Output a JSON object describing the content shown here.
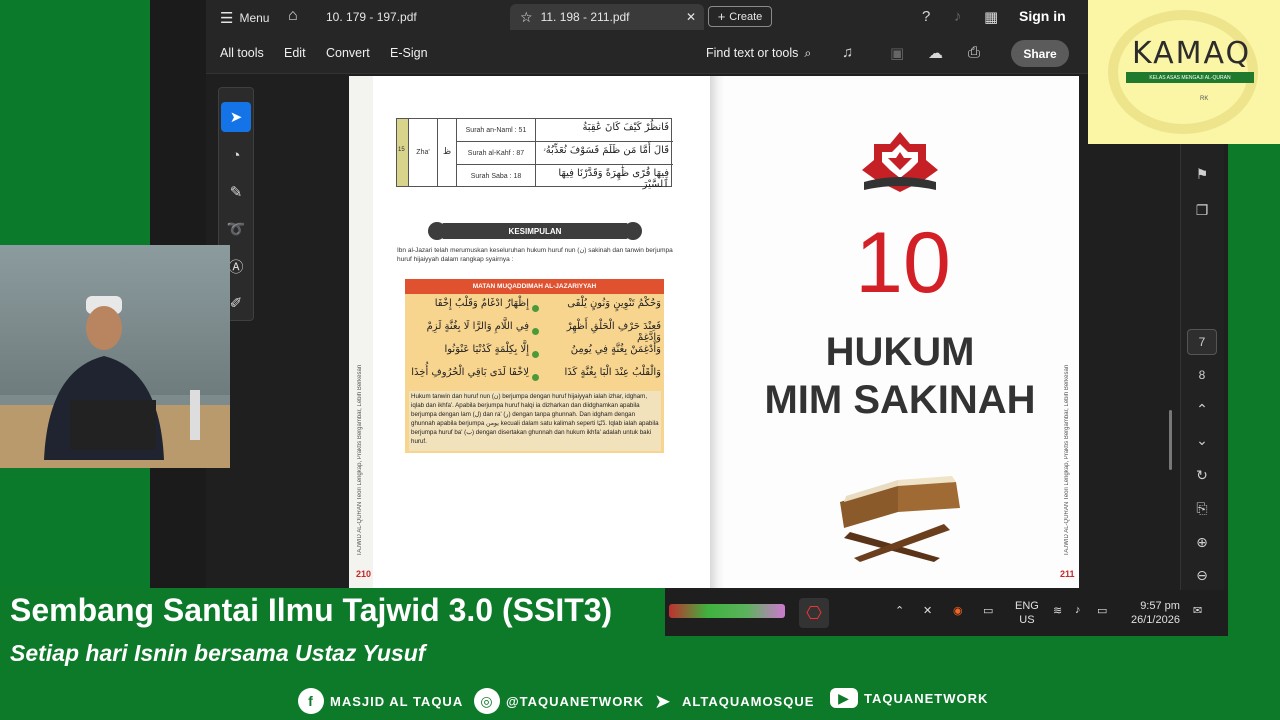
{
  "acrobat": {
    "menu_label": "Menu",
    "tabs": [
      {
        "label": "10. 179 - 197.pdf"
      },
      {
        "label": "11. 198 - 211.pdf"
      }
    ],
    "create_label": "Create",
    "sign_in": "Sign in",
    "menu": [
      "All tools",
      "Edit",
      "Convert",
      "E-Sign"
    ],
    "find_label": "Find text or tools",
    "share_label": "Share",
    "pages": {
      "current": "7",
      "next": "8"
    }
  },
  "left_page": {
    "table": {
      "number": "15",
      "letter_name": "Zha'",
      "letter": "ظ",
      "rows": [
        {
          "surah": "Surah an-Naml : 51",
          "arabic": "فَانظُرْ كَيْفَ كَانَ عَٰقِبَةُ"
        },
        {
          "surah": "Surah al-Kahf : 87",
          "arabic": "قَالَ أَمَّا مَن ظَلَمَ فَسَوْفَ نُعَذِّبُهُۥ"
        },
        {
          "surah": "Surah Saba : 18",
          "arabic": "فِيهَا قُرًى ظَٰهِرَةً وَقَدَّرْنَا فِيهَا ٱلسَّيْرَ"
        }
      ]
    },
    "kesimpulan": "KESIMPULAN",
    "intro": "Ibn al-Jazari telah merumuskan keseluruhan hukum huruf nun (ن) sakinah dan tanwin berjumpa huruf hijaiyyah dalam rangkap syairnya :",
    "matan_title": "MATAN MUQADDIMAH AL-JAZARIYYAH",
    "verses": [
      {
        "right": "وَحُكْمُ تَنْوِينٍ وَنُونٍ يُلْفَى",
        "left": "إِظْهَارٌ ادْغَامٌ وَقَلْبٌ إِخْفَا"
      },
      {
        "right": "فَعِنْدَ حَرْفِ الْحَلْقِ أَظْهِرْ وَادَّغِمْ",
        "left": "فِي اللَّامِ وَالرَّا لَا بِغُنَّةٍ لَزِمْ"
      },
      {
        "right": "وَأَدْغِمَنْ بِغُنَّةٍ فِي يُومِنُ",
        "left": "إِلَّا بِكِلْمَةٍ كَدُنْيَا عَنْوَنُوا"
      },
      {
        "right": "وَالْقَلْبُ عِنْدَ الْبَا بِغُنَّةٍ كَذَا",
        "left": "لِاخْفَا لَدَى بَاقِي الْحُرُوفِ أُخِذَا"
      }
    ],
    "note": "Hukum tanwin dan huruf nun (ن) berjumpa dengan huruf hijaiyyah ialah izhar, idgham, iqlab dan ikhfa'. Apabila berjumpa huruf halqi ia dizharkan dan diidghamkan apabila berjumpa dengan lam (ل) dan ra' (ر) dengan tanpa ghunnah. Dan idgham dengan ghunnah apabila berjumpa يومن kecuali dalam satu kalimah seperti دُنْيَا. Iqlab ialah apabila berjumpa huruf ba' (ب) dengan disertakan ghunnah dan hukum ikhfa' adalah untuk baki huruf.",
    "spine": "TAJWID AL-QURAN Teori Lengkap, Praktis Bergambar, Lebih Berkesan",
    "page_number": "210"
  },
  "right_page": {
    "chapter_number": "10",
    "title_line1": "HUKUM",
    "title_line2": "MIM SAKINAH",
    "spine": "TAJWID AL-QURAN Teori Lengkap, Praktis Bergambar, Lebih Berkesan",
    "page_number": "211"
  },
  "logo": {
    "word": "KAMAQ",
    "tagline": "KELAS ASAS MENGAJI AL-QURAN",
    "mini": "RK"
  },
  "taskbar": {
    "lang1": "ENG",
    "lang2": "US",
    "time": "9:57 pm",
    "date": "26/1/2026"
  },
  "overlay": {
    "title": "Sembang Santai Ilmu Tajwid 3.0 (SSIT3)",
    "subtitle": "Setiap hari Isnin bersama Ustaz Yusuf",
    "socials": [
      {
        "icon": "f",
        "label": "MASJID AL TAQUA"
      },
      {
        "icon": "◎",
        "label": "@TAQUANETWORK"
      },
      {
        "icon": "➤",
        "label": "ALTAQUAMOSQUE"
      },
      {
        "icon": "▶",
        "label": "TAQUANETWORK"
      }
    ]
  },
  "colors": {
    "brand_green": "#0d7a2a",
    "acrobat_red": "#d32027",
    "accent_blue": "#1473e6"
  }
}
